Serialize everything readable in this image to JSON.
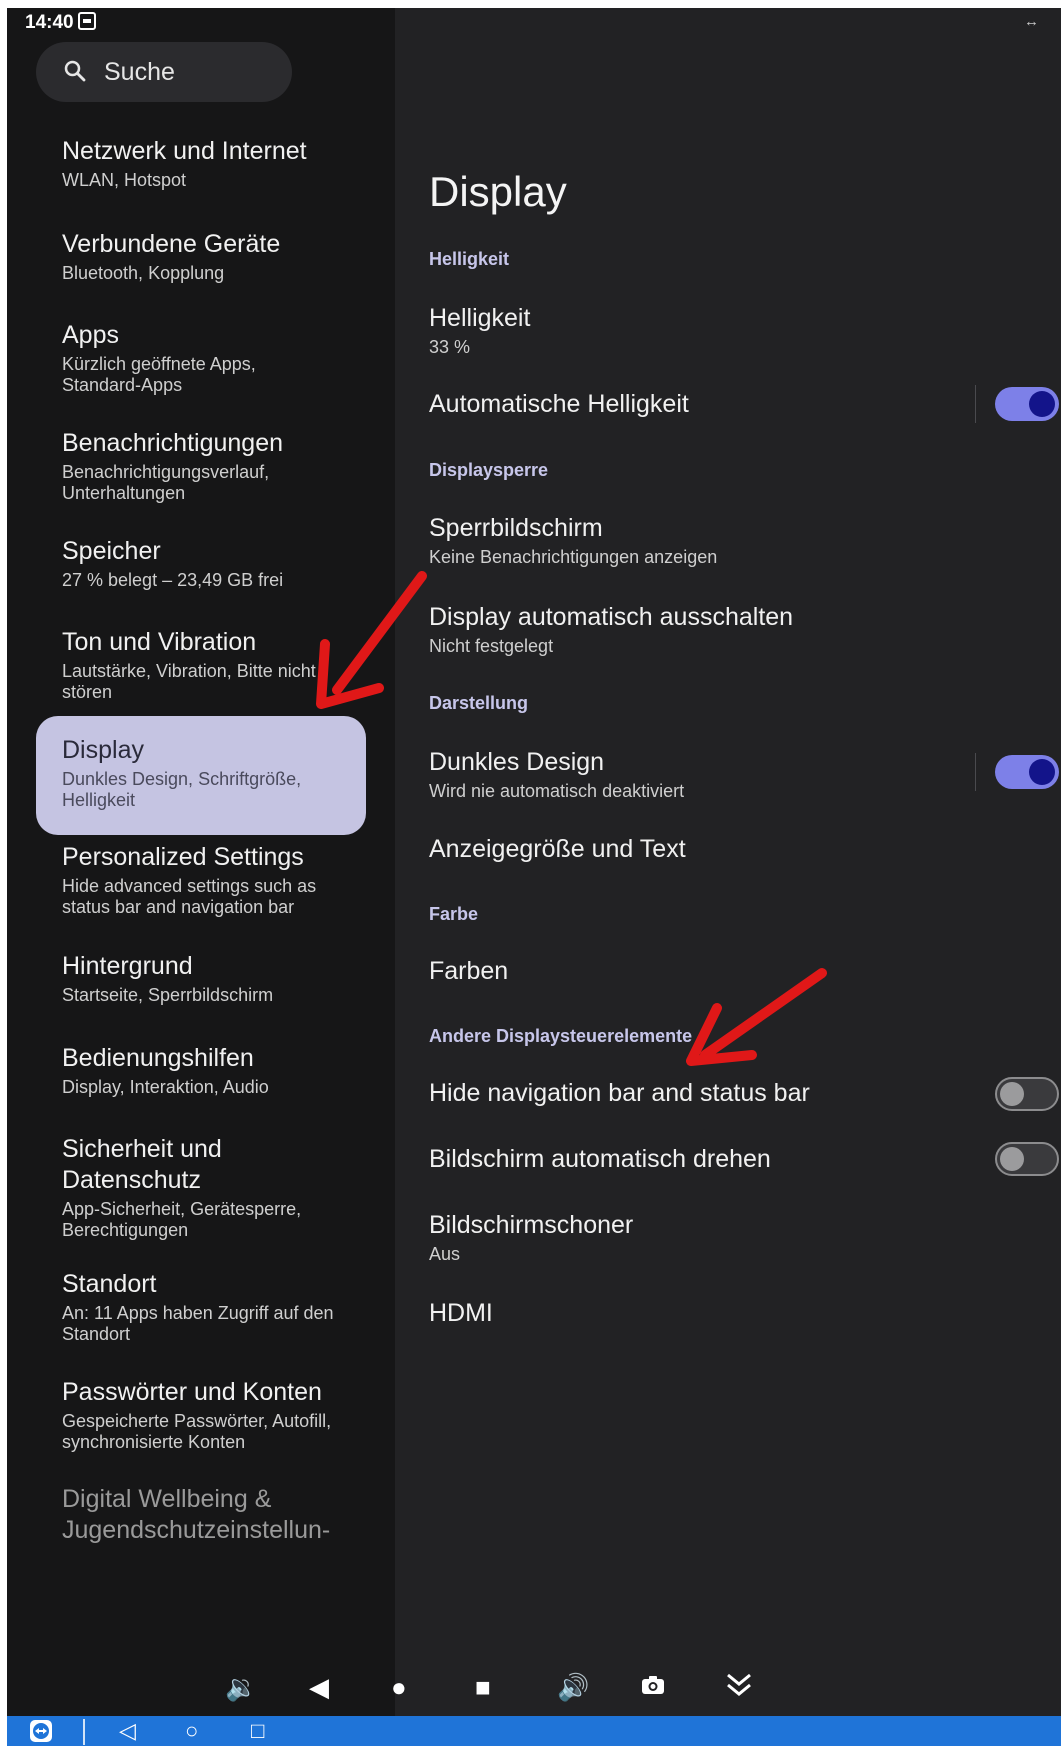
{
  "status_bar": {
    "time": "14:40"
  },
  "search": {
    "label": "Suche"
  },
  "sidebar": {
    "items": [
      {
        "title": "Netzwerk und Internet",
        "subtitle": "WLAN, Hotspot"
      },
      {
        "title": "Verbundene Geräte",
        "subtitle": "Bluetooth, Kopplung"
      },
      {
        "title": "Apps",
        "subtitle": "Kürzlich geöffnete Apps, Standard-Apps"
      },
      {
        "title": "Benachrichtigungen",
        "subtitle": "Benachrichtigungsverlauf, Unterhaltungen"
      },
      {
        "title": "Speicher",
        "subtitle": "27 % belegt – 23,49 GB frei"
      },
      {
        "title": "Ton und Vibration",
        "subtitle": "Lautstärke, Vibration, Bitte nicht stören"
      },
      {
        "title": "Display",
        "subtitle": "Dunkles Design, Schriftgröße, Helligkeit"
      },
      {
        "title": "Personalized Settings",
        "subtitle": "Hide advanced settings such as status bar and navigation bar"
      },
      {
        "title": "Hintergrund",
        "subtitle": "Startseite, Sperrbildschirm"
      },
      {
        "title": "Bedienungshilfen",
        "subtitle": "Display, Interaktion, Audio"
      },
      {
        "title": "Sicherheit und Datenschutz",
        "subtitle": "App-Sicherheit, Gerätesperre, Berechtigungen"
      },
      {
        "title": "Standort",
        "subtitle": "An: 11 Apps haben Zugriff auf den Standort"
      },
      {
        "title": "Passwörter und Konten",
        "subtitle": "Gespeicherte Passwörter, Autofill, synchronisierte Konten"
      },
      {
        "title": "Digital Wellbeing & Jugendschutzeinstellun-",
        "subtitle": ""
      }
    ]
  },
  "main": {
    "title": "Display",
    "sections": {
      "brightness": "Helligkeit",
      "lock": "Displaysperre",
      "appearance": "Darstellung",
      "color": "Farbe",
      "other": "Andere Displaysteuerelemente"
    },
    "rows": {
      "brightness": {
        "title": "Helligkeit",
        "subtitle": "33 %"
      },
      "auto_brightness": {
        "title": "Automatische Helligkeit",
        "enabled": true
      },
      "lock_screen": {
        "title": "Sperrbildschirm",
        "subtitle": "Keine Benachrichtigungen anzeigen"
      },
      "screen_timeout": {
        "title": "Display automatisch ausschalten",
        "subtitle": "Nicht festgelegt"
      },
      "dark_theme": {
        "title": "Dunkles Design",
        "subtitle": "Wird nie automatisch deaktiviert",
        "enabled": true
      },
      "display_size": {
        "title": "Anzeigegröße und Text"
      },
      "colors": {
        "title": "Farben"
      },
      "hide_nav": {
        "title": "Hide navigation bar and status bar",
        "enabled": false
      },
      "auto_rotate": {
        "title": "Bildschirm automatisch drehen",
        "enabled": false
      },
      "screensaver": {
        "title": "Bildschirmschoner",
        "subtitle": "Aus"
      },
      "hdmi": {
        "title": "HDMI"
      }
    }
  },
  "colors": {
    "accent": "#7d80e8",
    "selected_bg": "#c5c4e2",
    "annotation_arrow": "#e01818",
    "taskbar": "#1f74d8"
  },
  "icons": {
    "floating_toolbar": [
      "volume-down-icon",
      "back-triangle-icon",
      "home-circle-icon",
      "recents-square-icon",
      "volume-up-icon",
      "camera-icon",
      "collapse-chevron-icon"
    ],
    "bottom_bar": [
      "teamviewer-icon",
      "back-icon",
      "home-icon",
      "recents-icon"
    ]
  }
}
